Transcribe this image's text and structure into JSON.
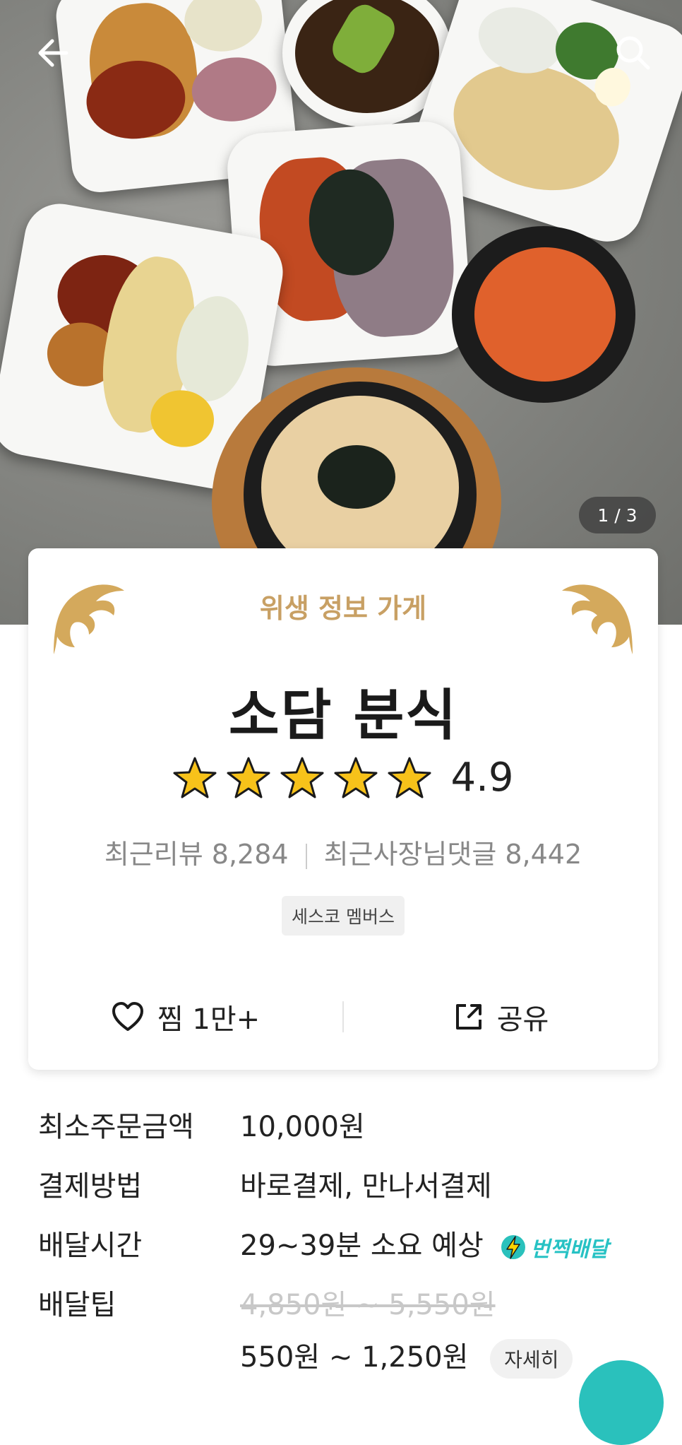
{
  "hero": {
    "counter": "1 / 3"
  },
  "nav": {
    "back_icon": "arrow-left-icon",
    "search_icon": "search-icon"
  },
  "card": {
    "hygiene_label": "위생 정보 가게",
    "store_name": "소담 분식",
    "rating": "4.9",
    "rating_stars": 5,
    "recent_reviews": "최근리뷰 8,284",
    "recent_owner_replies": "최근사장님댓글 8,442",
    "member_badge": "세스코 멤버스",
    "like_label": "찜 1만+",
    "share_label": "공유"
  },
  "info": {
    "min_order_label": "최소주문금액",
    "min_order_value": "10,000원",
    "payment_label": "결제방법",
    "payment_value": "바로결제, 만나서결제",
    "delivery_time_label": "배달시간",
    "delivery_time_value": "29~39분 소요 예상",
    "lightning_label": "번쩍배달",
    "tip_label": "배달팁",
    "tip_original": "4,850원 ~ 5,550원",
    "tip_discounted": "550원 ~ 1,250원",
    "detail_button": "자세히"
  },
  "colors": {
    "accent": "#2ac1bc",
    "hygiene_gold": "#c8a064",
    "star_yellow": "#f7c21a"
  }
}
